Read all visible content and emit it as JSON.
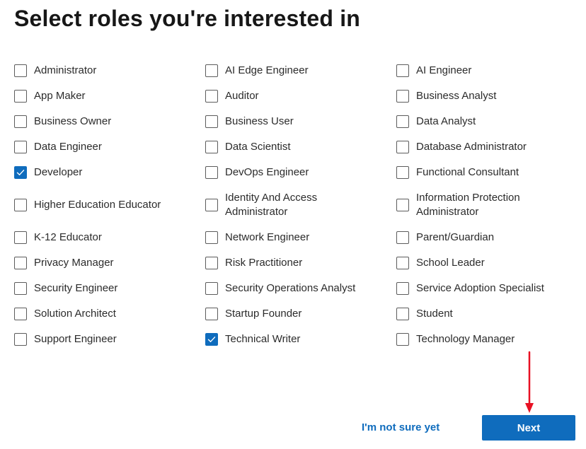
{
  "page": {
    "title": "Select roles you're interested in"
  },
  "roles": {
    "col1": [
      {
        "label": "Administrator",
        "checked": false
      },
      {
        "label": "App Maker",
        "checked": false
      },
      {
        "label": "Business Owner",
        "checked": false
      },
      {
        "label": "Data Engineer",
        "checked": false
      },
      {
        "label": "Developer",
        "checked": true
      },
      {
        "label": "Higher Education Educator",
        "checked": false
      },
      {
        "label": "K-12 Educator",
        "checked": false
      },
      {
        "label": "Privacy Manager",
        "checked": false
      },
      {
        "label": "Security Engineer",
        "checked": false
      },
      {
        "label": "Solution Architect",
        "checked": false
      },
      {
        "label": "Support Engineer",
        "checked": false
      }
    ],
    "col2": [
      {
        "label": "AI Edge Engineer",
        "checked": false
      },
      {
        "label": "Auditor",
        "checked": false
      },
      {
        "label": "Business User",
        "checked": false
      },
      {
        "label": "Data Scientist",
        "checked": false
      },
      {
        "label": "DevOps Engineer",
        "checked": false
      },
      {
        "label": "Identity And Access Administrator",
        "checked": false
      },
      {
        "label": "Network Engineer",
        "checked": false
      },
      {
        "label": "Risk Practitioner",
        "checked": false
      },
      {
        "label": "Security Operations Analyst",
        "checked": false
      },
      {
        "label": "Startup Founder",
        "checked": false
      },
      {
        "label": "Technical Writer",
        "checked": true
      }
    ],
    "col3": [
      {
        "label": "AI Engineer",
        "checked": false
      },
      {
        "label": "Business Analyst",
        "checked": false
      },
      {
        "label": "Data Analyst",
        "checked": false
      },
      {
        "label": "Database Administrator",
        "checked": false
      },
      {
        "label": "Functional Consultant",
        "checked": false
      },
      {
        "label": "Information Protection Administrator",
        "checked": false
      },
      {
        "label": "Parent/Guardian",
        "checked": false
      },
      {
        "label": "School Leader",
        "checked": false
      },
      {
        "label": "Service Adoption Specialist",
        "checked": false
      },
      {
        "label": "Student",
        "checked": false
      },
      {
        "label": "Technology Manager",
        "checked": false
      }
    ]
  },
  "actions": {
    "not_sure_label": "I'm not sure yet",
    "next_label": "Next"
  },
  "colors": {
    "accent": "#0f6cbd",
    "annotation": "#e81123"
  },
  "icons": {
    "checkmark": "checkmark-icon",
    "annotation": "red-arrow-icon"
  }
}
